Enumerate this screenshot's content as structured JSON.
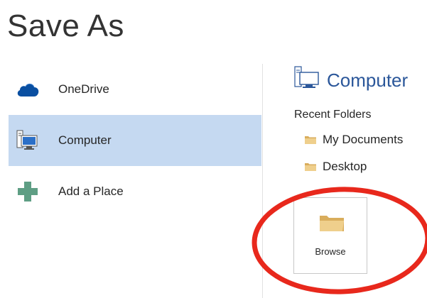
{
  "page": {
    "title": "Save As"
  },
  "places": {
    "items": [
      {
        "label": "OneDrive",
        "icon": "cloud-icon",
        "selected": false
      },
      {
        "label": "Computer",
        "icon": "computer-icon",
        "selected": true
      },
      {
        "label": "Add a Place",
        "icon": "plus-icon",
        "selected": false
      }
    ]
  },
  "location": {
    "title": "Computer",
    "icon": "computer-icon",
    "recent_heading": "Recent Folders",
    "recent_folders": [
      {
        "label": "My Documents",
        "icon": "folder-icon"
      },
      {
        "label": "Desktop",
        "icon": "folder-icon"
      }
    ],
    "browse_label": "Browse"
  },
  "colors": {
    "accent": "#2b579a",
    "selected_bg": "#c5d9f1",
    "onedrive_blue": "#0a4fa1",
    "add_place_green": "#5e9e84",
    "folder_tan": "#e6c27a",
    "highlight_red": "#e8281c"
  }
}
